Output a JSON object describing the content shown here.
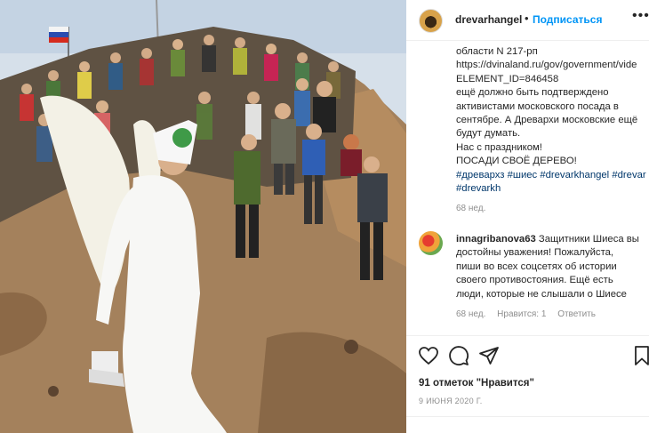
{
  "post": {
    "username": "drevarhangel",
    "separator": "•",
    "follow_label": "Подписаться",
    "more_label": "•••",
    "caption_lines": [
      "области N 217-рп",
      "https://dvinaland.ru/gov/government/vide",
      "ELEMENT_ID=846458",
      "ещё должно быть подтверждено",
      "активистами московского посада в",
      "сентябре. А Древархи московские ещё",
      "будут думать.",
      "Нас с праздником!",
      "ПОСАДИ СВОЁ ДЕРЕВО!"
    ],
    "hashtag_lines": [
      "#древархз #шиес #drevarkhangel #drevar",
      "#drevarkh"
    ],
    "caption_time": "68 нед."
  },
  "comment": {
    "username": "innagribanova63",
    "text_lines": [
      " Защитники Шиеса вы",
      "достойны уважения! Пожалуйста,",
      "пиши во всех соцсетях об истории",
      "своего противостояния. Ещё есть",
      "люди, которые не слышали о Шиесе"
    ],
    "time": "68 нед.",
    "likes": "Нравится: 1",
    "reply": "Ответить"
  },
  "footer": {
    "likes_label": "91 отметок \"Нравится\"",
    "date": "9 ИЮНЯ 2020 Г."
  },
  "icons": [
    "heart-icon",
    "comment-icon",
    "share-icon",
    "bookmark-icon"
  ],
  "colors": {
    "link": "#0095f6",
    "hashtag": "#00376b",
    "muted": "#8e8e8e"
  }
}
